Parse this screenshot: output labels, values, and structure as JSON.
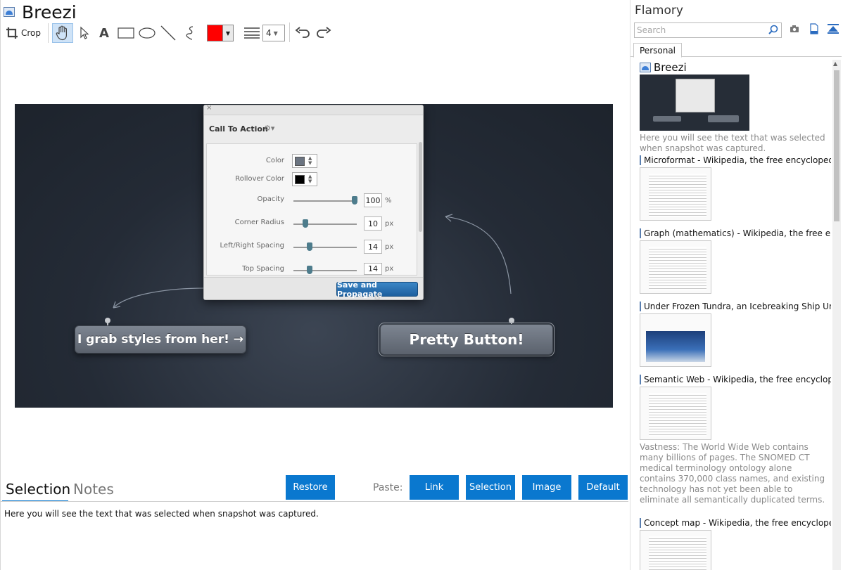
{
  "app": {
    "title": "Breezi"
  },
  "toolbar": {
    "crop_label": "Crop",
    "color": "#ff0000",
    "line_size": "4"
  },
  "canvas": {
    "dialog": {
      "title": "Call To Action",
      "close": "×",
      "gear": "⚙▾",
      "props": {
        "color": "Color",
        "rollover": "Rollover Color",
        "opacity": "Opacity",
        "opacity_value": "100",
        "opacity_unit": "%",
        "corner_radius": "Corner Radius",
        "corner_value": "10",
        "corner_unit": "px",
        "lr_spacing": "Left/Right Spacing",
        "lr_value": "14",
        "lr_unit": "px",
        "top_spacing": "Top Spacing",
        "top_value": "14",
        "top_unit": "px"
      },
      "save_button": "Save and Propagate"
    },
    "grab_button": "I grab styles from her! →",
    "pretty_button": "Pretty Button!"
  },
  "bottom": {
    "tab_selection": "Selection",
    "tab_notes": "Notes",
    "restore": "Restore",
    "paste_label": "Paste:",
    "paste_link": "Link",
    "paste_selection": "Selection",
    "paste_image": "Image",
    "paste_default": "Default",
    "selection_text": "Here you will see the text that was selected when snapshot was captured."
  },
  "sidebar": {
    "title": "Flamory",
    "search_placeholder": "Search",
    "tab": "Personal",
    "items": [
      {
        "title": "Breezi",
        "desc": "Here you will see the text that was selected when snapshot was captured."
      },
      {
        "title": "Microformat - Wikipedia, the free encyclopedia"
      },
      {
        "title": "Graph (mathematics) - Wikipedia, the free ency"
      },
      {
        "title": "Under Frozen Tundra, an Icebreaking Ship Unco"
      },
      {
        "title": "Semantic Web - Wikipedia, the free encycloped",
        "desc": "Vastness: The World Wide Web contains many billions of pages. The SNOMED CT medical terminology ontology alone contains 370,000 class names, and existing technology has not yet been able to eliminate all semantically duplicated terms. Any automated reasoning system will have to deal with truly huge inputs."
      },
      {
        "title": "Concept map - Wikipedia, the free encyclopedia"
      }
    ]
  }
}
